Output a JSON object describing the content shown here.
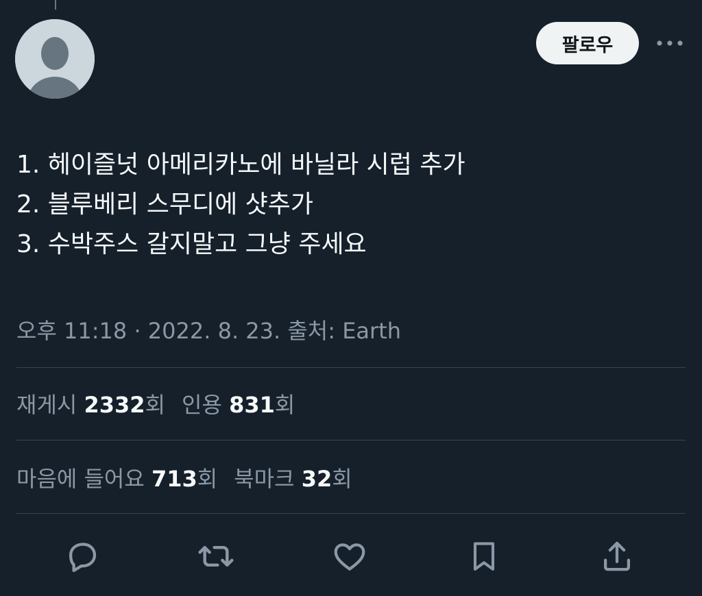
{
  "tweet": {
    "lines": [
      "1. 헤이즐넛 아메리카노에 바닐라 시럽 추가",
      "2. 블루베리 스무디에 샷추가",
      "3. 수박주스 갈지말고 그냥 주세요"
    ],
    "time": "오후 11:18",
    "separator": "·",
    "date": "2022. 8. 23.",
    "source_label": "출처:",
    "source": "Earth"
  },
  "header": {
    "follow_label": "팔로우",
    "avatar_icon": "default-avatar-icon",
    "more_icon": "more-icon"
  },
  "stats": {
    "retweets_label": "재게시",
    "retweets_value": "2332",
    "retweets_unit": "회",
    "quotes_label": "인용",
    "quotes_value": "831",
    "quotes_unit": "회",
    "likes_label": "마음에 들어요",
    "likes_value": "713",
    "likes_unit": "회",
    "bookmarks_label": "북마크",
    "bookmarks_value": "32",
    "bookmarks_unit": "회"
  },
  "actions": [
    "reply-icon",
    "retweet-icon",
    "like-icon",
    "bookmark-icon",
    "share-icon"
  ],
  "colors": {
    "background": "#15202b",
    "text": "#f7f9f9",
    "secondary_text": "#8b98a5",
    "divider": "#38444d",
    "follow_bg": "#eff3f4",
    "icon": "#8b98a5"
  }
}
